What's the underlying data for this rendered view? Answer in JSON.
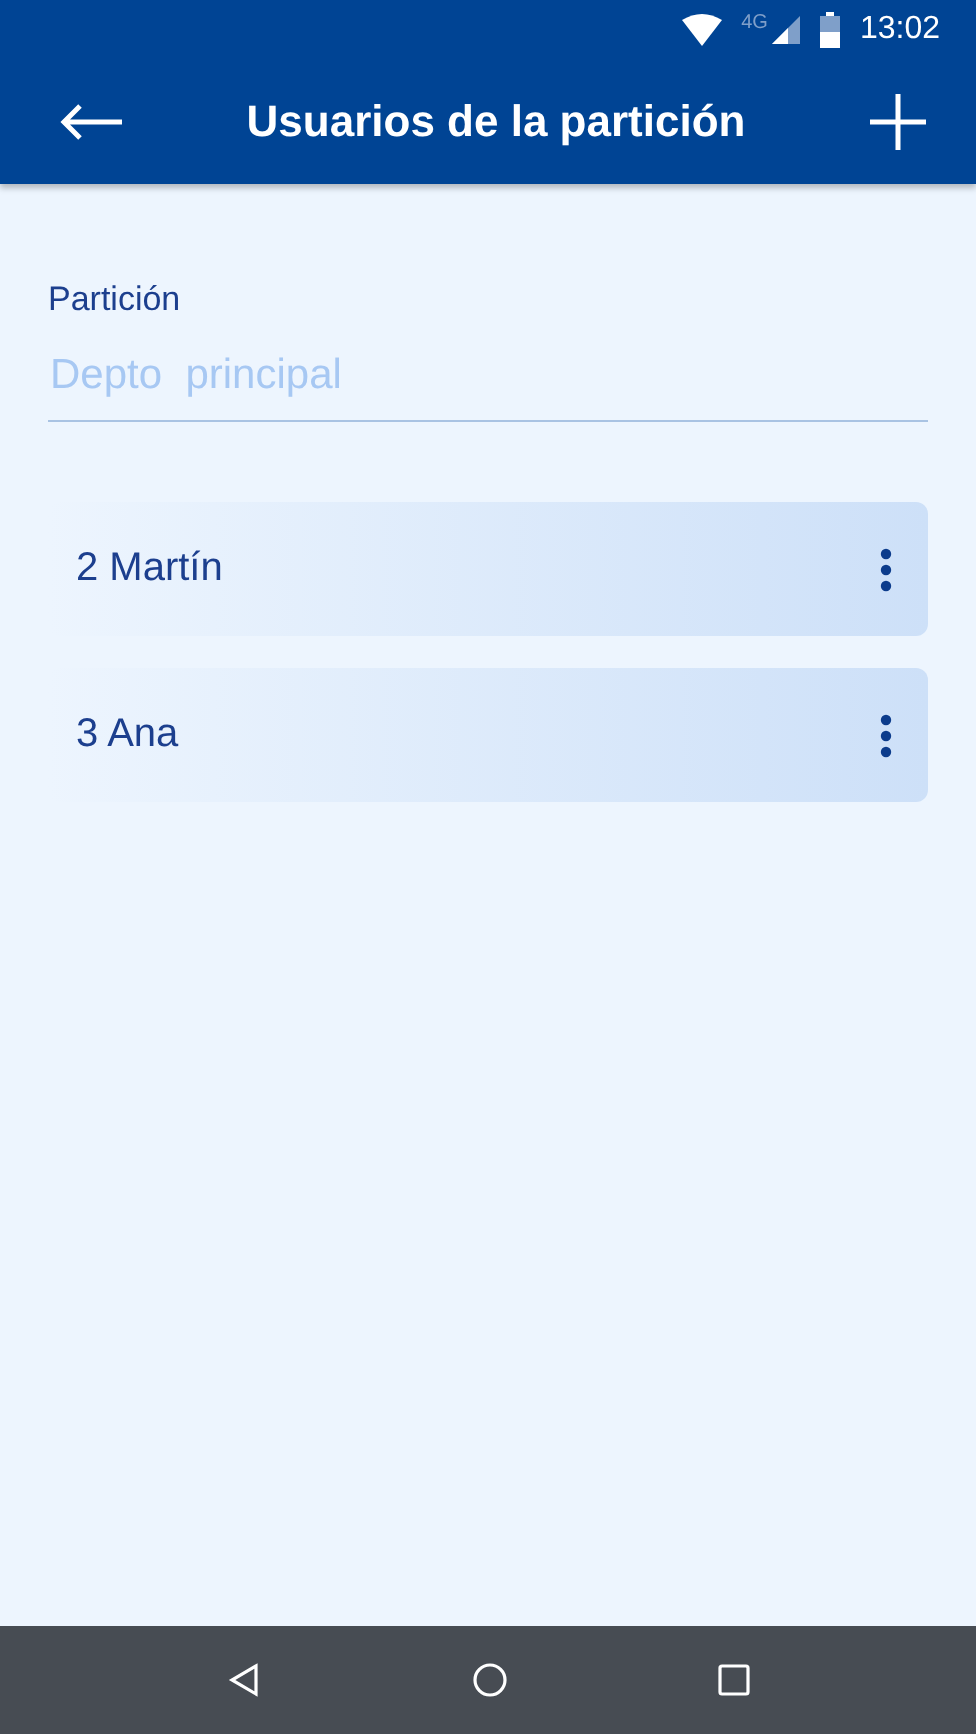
{
  "status_bar": {
    "network": "4G",
    "time": "13:02"
  },
  "app_bar": {
    "title": "Usuarios de la partición"
  },
  "partition_field": {
    "label": "Partición",
    "placeholder": "Depto  principal"
  },
  "users": [
    {
      "label": "2 Martín"
    },
    {
      "label": "3 Ana"
    }
  ]
}
